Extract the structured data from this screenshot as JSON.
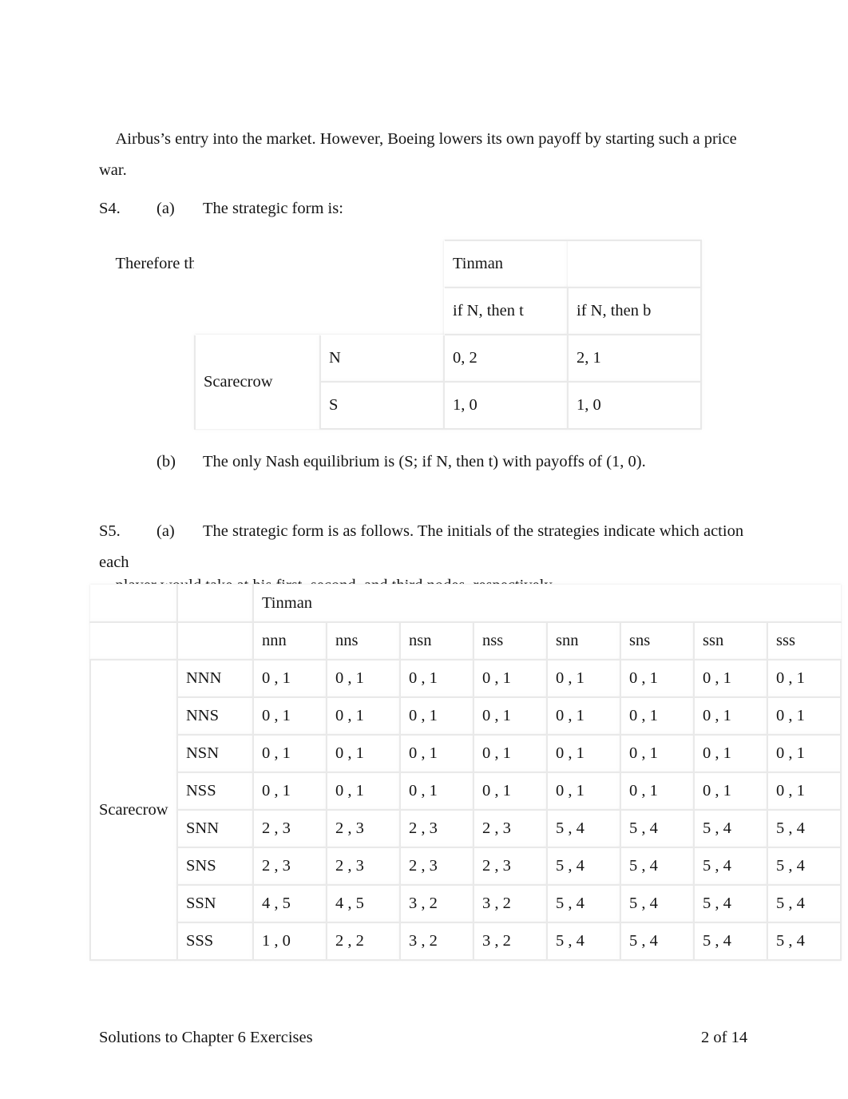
{
  "document": {
    "footer_left": "Solutions to Chapter 6 Exercises",
    "footer_right": "2 of 14"
  },
  "intro": {
    "line1": "Airbus’s entry into the market. However, Boeing lowers its own payoff by starting such a price war.",
    "line2": "Therefore threat to do so is not credible."
  },
  "s4": {
    "number": "S4.",
    "part_a": "(a)",
    "part_a_text": "The strategic form is:",
    "part_b": "(b)",
    "part_b_text": "The only Nash equilibrium is (S; if N, then t) with payoffs of (1, 0).",
    "table": {
      "column_player": "Tinman",
      "row_player": "Scarecrow",
      "column_headers": [
        "if N, then t",
        "if N, then b"
      ],
      "row_headers": [
        "N",
        "S"
      ],
      "cells": [
        [
          "0, 2",
          "2, 1"
        ],
        [
          "1, 0",
          "1, 0"
        ]
      ]
    }
  },
  "s5": {
    "number": "S5.",
    "part_a": "(a)",
    "part_a_text_line1": "The strategic form is as follows. The initials of the strategies indicate which action each",
    "part_a_text_line2": "player would take at his first, second, and third nodes, respectively.",
    "table": {
      "column_player": "Tinman",
      "row_player": "Scarecrow",
      "column_headers": [
        "nnn",
        "nns",
        "nsn",
        "nss",
        "snn",
        "sns",
        "ssn",
        "sss"
      ],
      "row_headers": [
        "NNN",
        "NNS",
        "NSN",
        "NSS",
        "SNN",
        "SNS",
        "SSN",
        "SSS"
      ],
      "cells": [
        [
          "0 , 1",
          "0 , 1",
          "0 , 1",
          "0 , 1",
          "0 , 1",
          "0 , 1",
          "0 , 1",
          "0 , 1"
        ],
        [
          "0 , 1",
          "0 , 1",
          "0 , 1",
          "0 , 1",
          "0 , 1",
          "0 , 1",
          "0 , 1",
          "0 , 1"
        ],
        [
          "0 , 1",
          "0 , 1",
          "0 , 1",
          "0 , 1",
          "0 , 1",
          "0 , 1",
          "0 , 1",
          "0 , 1"
        ],
        [
          "0 , 1",
          "0 , 1",
          "0 , 1",
          "0 , 1",
          "0 , 1",
          "0 , 1",
          "0 , 1",
          "0 , 1"
        ],
        [
          "2 , 3",
          "2 , 3",
          "2 , 3",
          "2 , 3",
          "5 , 4",
          "5 , 4",
          "5 , 4",
          "5 , 4"
        ],
        [
          "2 , 3",
          "2 , 3",
          "2 , 3",
          "2 , 3",
          "5 , 4",
          "5 , 4",
          "5 , 4",
          "5 , 4"
        ],
        [
          "4 , 5",
          "4 , 5",
          "3 , 2",
          "3 , 2",
          "5 , 4",
          "5 , 4",
          "5 , 4",
          "5 , 4"
        ],
        [
          "1 , 0",
          "2 , 2",
          "3 , 2",
          "3 , 2",
          "5 , 4",
          "5 , 4",
          "5 , 4",
          "5 , 4"
        ]
      ]
    }
  }
}
